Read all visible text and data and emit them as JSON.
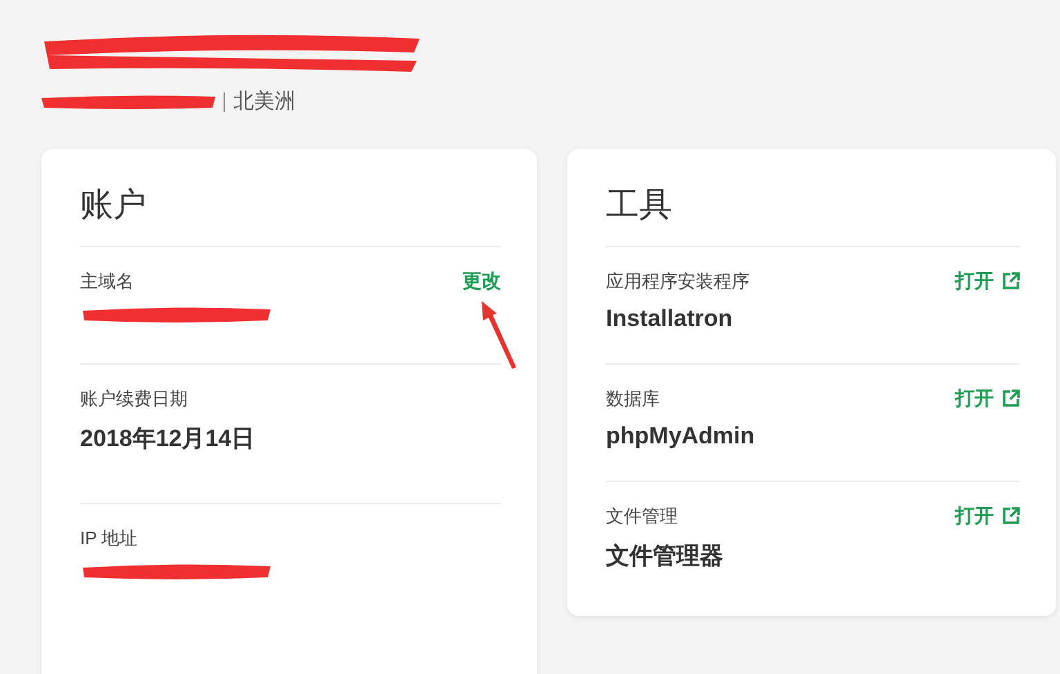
{
  "header": {
    "title_redacted": true,
    "subtitle_redacted": true,
    "region": "北美洲"
  },
  "cards": [
    {
      "title": "账户",
      "rows": [
        {
          "label": "主域名",
          "value_redacted": true,
          "action": {
            "label": "更改",
            "external": false
          }
        },
        {
          "label": "账户续费日期",
          "value": "2018年12月14日"
        },
        {
          "label": "IP 地址",
          "value_redacted": true
        }
      ]
    },
    {
      "title": "工具",
      "rows": [
        {
          "label": "应用程序安装程序",
          "value": "Installatron",
          "action": {
            "label": "打开",
            "external": true
          }
        },
        {
          "label": "数据库",
          "value": "phpMyAdmin",
          "action": {
            "label": "打开",
            "external": true
          }
        },
        {
          "label": "文件管理",
          "value": "文件管理器",
          "action": {
            "label": "打开",
            "external": true
          }
        }
      ]
    }
  ],
  "annotations": [
    {
      "kind": "arrow"
    }
  ]
}
